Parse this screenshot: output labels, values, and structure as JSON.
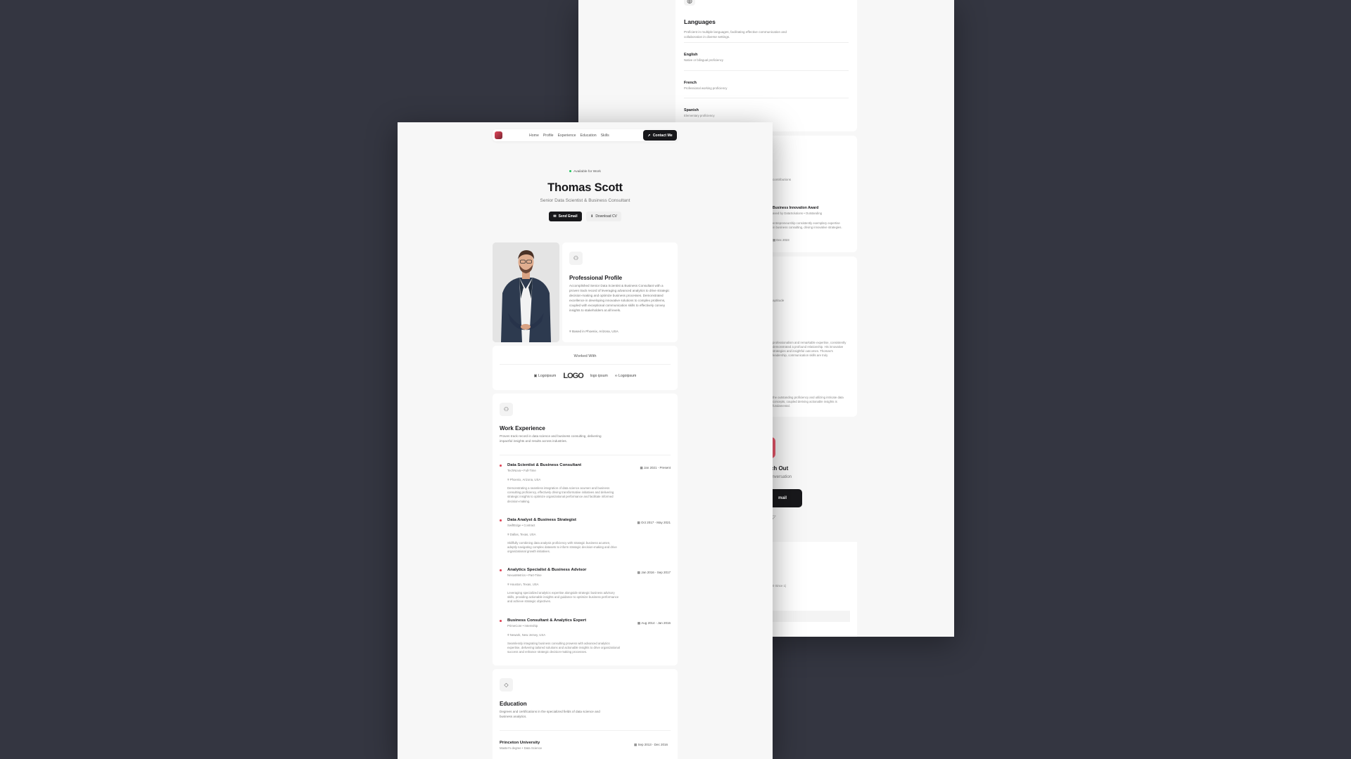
{
  "back_page": {
    "languages": {
      "heading": "Languages",
      "description": "Proficient in multiple languages, facilitating effective communication and collaboration in diverse settings.",
      "items": [
        {
          "name": "English",
          "level": "Native or bilingual proficiency"
        },
        {
          "name": "French",
          "level": "Professional working proficiency"
        },
        {
          "name": "Spanish",
          "level": "Elementary proficiency"
        }
      ]
    },
    "award": {
      "intro_fragment": "contributions",
      "title_fragment": "Business Innovation Award",
      "org_fragment": "ased by DataSolutions • Outstanding",
      "desc_fragment": "entrepreneurship consistently exemplary expertise in business consulting, driving innovative strategies.",
      "date_fragment": "Dec 2023"
    },
    "third": {
      "intro_fragment": "aptitude",
      "para1": "professionalism and remarkable expertise, consistently demonstrated a profound relationship. His innovative strategies and insightful outcomes. Thomas's leadership, communication skills are truly",
      "para2": "the outstanding proficiency and utilizing intricate data concepts, coupled deriving actionable insights is fundamental."
    },
    "contact": {
      "reach_fragment": "each Out",
      "conv_fragment": "e conversation",
      "email_fragment": "mail"
    },
    "bottom": {
      "fragment": "0 Since 1)"
    }
  },
  "nav": {
    "links": [
      "Home",
      "Profile",
      "Experience",
      "Education",
      "Skills"
    ],
    "contact_label": "Contact Me"
  },
  "hero": {
    "availability": "Available for Work",
    "name": "Thomas Scott",
    "title": "Senior Data Scientist & Business Consultant",
    "send_email": "Send Email",
    "download_cv": "Download CV"
  },
  "profile": {
    "heading": "Professional Profile",
    "text": "Accomplished Senior Data Scientist & Business Consultant with a proven track record of leveraging advanced analytics to drive strategic decision-making and optimize business processes. Demonstrated excellence in developing innovative solutions to complex problems, coupled with exceptional communication skills to effectively convey insights to stakeholders at all levels.",
    "location": "Based in Phoenix, Arizona, USA"
  },
  "worked_with": {
    "heading": "Worked With",
    "logos": [
      "Logoipsum",
      "LOGO",
      "logo ipsum",
      "Logoipsum"
    ]
  },
  "experience": {
    "heading": "Work Experience",
    "description": "Proven track record in data science and business consulting, delivering impactful insights and results across industries.",
    "jobs": [
      {
        "role": "Data Scientist & Business Consultant",
        "company": "TechNova • Full-Time",
        "dates": "Jan 2021 - Present",
        "location": "Phoenix, Arizona, USA",
        "description": "Demonstrating a seamless integration of data science acumen and business consulting proficiency, effectively driving transformative initiatives and delivering strategic insights to optimize organizational performance and facilitate informed decision-making."
      },
      {
        "role": "Data Analyst & Business Strategist",
        "company": "SwiftEdge • Contract",
        "dates": "Oct 2017 - May 2021",
        "location": "Dallas, Texas, USA",
        "description": "Skillfully combining data analysis proficiency with strategic business acumen, adeptly navigating complex datasets to inform strategic decision-making and drive organizational growth initiatives."
      },
      {
        "role": "Analytics Specialist & Business Advisor",
        "company": "NexusMetrics • Part-Time",
        "dates": "Jan 2016 - Sep 2017",
        "location": "Houston, Texas, USA",
        "description": "Leveraging specialized analytics expertise alongside strategic business advisory skills, providing actionable insights and guidance to optimize business performance and achieve strategic objectives."
      },
      {
        "role": "Business Consultant & Analytics Expert",
        "company": "PrimeCore • Internship",
        "dates": "Aug 2014 - Jan 2016",
        "location": "Newark, New Jersey, USA",
        "description": "Seamlessly integrating business consulting prowess with advanced analytics expertise, delivering tailored solutions and actionable insights to drive organizational success and enhance strategic decision-making processes."
      }
    ]
  },
  "education": {
    "heading": "Education",
    "description": "Degrees and certifications in the specialized fields of data science and business analytics.",
    "items": [
      {
        "school": "Princeton University",
        "degree": "Master's degree • Data Science",
        "dates": "Sep 2013 - Dec 2016"
      }
    ]
  },
  "colors": {
    "background": "#343641",
    "accent": "#e0475a",
    "dark": "#18181b",
    "available": "#22c55e"
  },
  "icons": {
    "globe": "globe-icon",
    "mail": "mail-icon",
    "download": "download-icon",
    "pin": "map-pin-icon",
    "calendar": "calendar-icon",
    "briefcase": "briefcase-icon",
    "graduation": "graduation-cap-icon",
    "send": "send-icon"
  }
}
